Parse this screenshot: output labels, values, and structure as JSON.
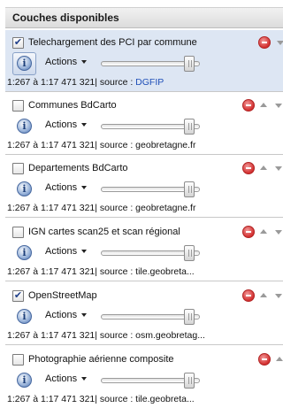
{
  "panel": {
    "title": "Couches disponibles"
  },
  "actions_label": "Actions",
  "layers": [
    {
      "title": "Telechargement des PCI par commune",
      "checked": true,
      "selected": true,
      "scale": "1:267 à 1:17 471 321| source : ",
      "source": "DGFIP",
      "source_is_link": true,
      "show_up": false,
      "opacity": 1.0
    },
    {
      "title": "Communes BdCarto",
      "checked": false,
      "selected": false,
      "scale": "1:267 à 1:17 471 321| source : ",
      "source": "geobretagne.fr",
      "source_is_link": false,
      "show_up": true,
      "opacity": 1.0
    },
    {
      "title": "Departements BdCarto",
      "checked": false,
      "selected": false,
      "scale": "1:267 à 1:17 471 321| source : ",
      "source": "geobretagne.fr",
      "source_is_link": false,
      "show_up": true,
      "opacity": 1.0
    },
    {
      "title": "IGN cartes scan25 et scan régional",
      "checked": false,
      "selected": false,
      "scale": "1:267 à 1:17 471 321| source : ",
      "source": "tile.geobreta...",
      "source_is_link": false,
      "show_up": true,
      "opacity": 1.0
    },
    {
      "title": "OpenStreetMap",
      "checked": true,
      "selected": false,
      "scale": "1:267 à 1:17 471 321| source : ",
      "source": "osm.geobretag...",
      "source_is_link": false,
      "show_up": true,
      "opacity": 1.0
    },
    {
      "title": "Photographie aérienne composite",
      "checked": false,
      "selected": false,
      "scale": "1:267 à 1:17 471 321| source : ",
      "source": "tile.geobreta...",
      "source_is_link": false,
      "show_up": true,
      "opacity": 1.0
    }
  ],
  "icons": {
    "checkmark": "✔",
    "info": "i"
  },
  "colors": {
    "selected_row": "#dde6f3",
    "link": "#1f4fb8",
    "remove": "#d32f2f"
  }
}
